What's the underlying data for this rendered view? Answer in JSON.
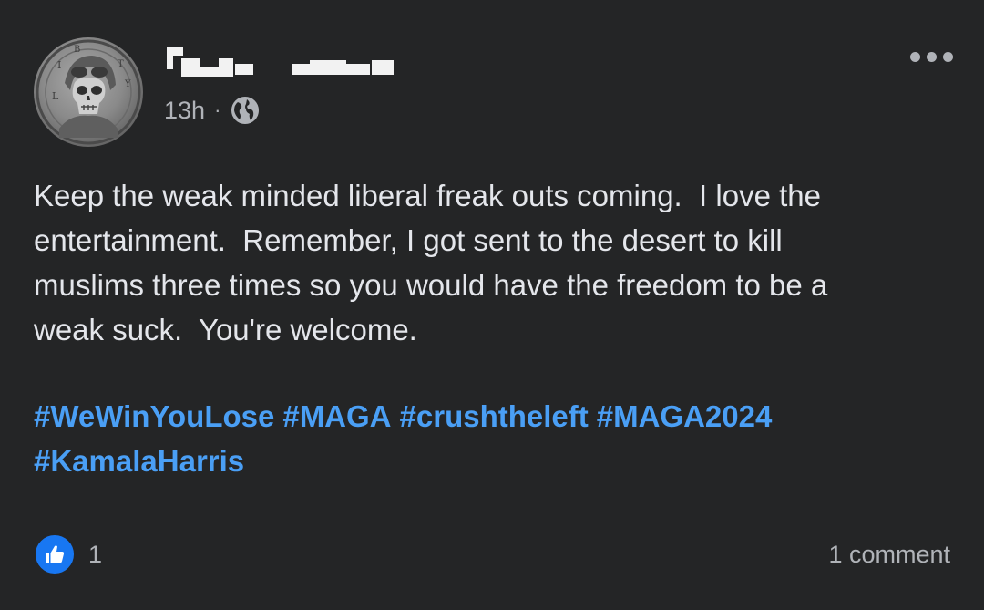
{
  "post": {
    "author": {
      "avatar_icon": "skull-aviator-coin-avatar",
      "name_redacted": true
    },
    "timestamp": "13h",
    "separator": "·",
    "privacy_icon": "globe-icon",
    "more_icon": "more-options-icon",
    "body": "Keep the weak minded liberal freak outs coming.  I love the\nentertainment.  Remember, I got sent to the desert to kill\nmuslims three times so you would have the freedom to be a\nweak suck.  You're welcome.",
    "hashtags": [
      "#WeWinYouLose",
      "#MAGA",
      "#crushtheleft",
      "#MAGA2024",
      "#KamalaHarris"
    ],
    "reactions": {
      "icon": "like-icon",
      "count": "1"
    },
    "comments": "1 comment"
  },
  "colors": {
    "background": "#242526",
    "text_primary": "#e4e6eb",
    "text_secondary": "#b0b3b8",
    "hashtag": "#4a9ff5",
    "like_badge": "#1877f2"
  }
}
